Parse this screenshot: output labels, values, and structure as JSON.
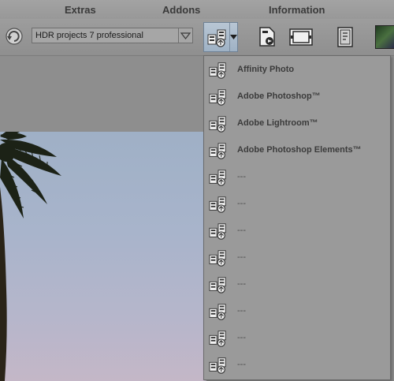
{
  "menubar": {
    "items": [
      "Extras",
      "Addons",
      "Information"
    ]
  },
  "toolbar": {
    "preset_value": "HDR projects 7 professional"
  },
  "icons": {
    "refresh": "refresh-icon",
    "plugin": "plugin-export-icon",
    "save": "save-file-icon",
    "filmstrip": "filmstrip-icon",
    "info": "info-panel-icon",
    "thumbnail": "thumbnail-icon"
  },
  "plugin_menu": {
    "items": [
      "Affinity Photo",
      "Adobe Photoshop™",
      "Adobe Lightroom™",
      "Adobe Photoshop Elements™",
      "---",
      "---",
      "---",
      "---",
      "---",
      "---",
      "---",
      "---"
    ]
  },
  "colors": {
    "background": "#8d8d8d",
    "menu_highlight": "#b8c6d4",
    "sky": "#a8b4cb"
  }
}
